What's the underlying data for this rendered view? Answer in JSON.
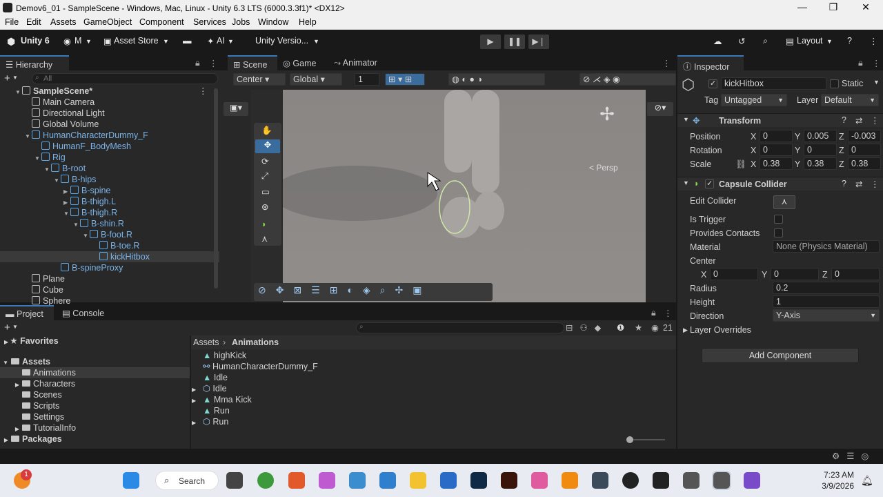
{
  "window": {
    "title": "Demov6_01 - SampleScene - Windows, Mac, Linux - Unity 6.3 LTS (6000.3.3f1)* <DX12>",
    "minimize": "—",
    "maximize": "❐",
    "close": "✕"
  },
  "menu": [
    "File",
    "Edit",
    "Assets",
    "GameObject",
    "Component",
    "Services",
    "Jobs",
    "Window",
    "Help"
  ],
  "toolbar": {
    "product": "Unity 6",
    "account": "M",
    "asset_store": "Asset Store",
    "ai": "AI",
    "version_control": "Unity Versio...",
    "layout": "Layout"
  },
  "hierarchy": {
    "tab": "Hierarchy",
    "search_placeholder": "All",
    "rows": [
      {
        "label": "SampleScene*",
        "indent": 0
      },
      {
        "label": "Main Camera",
        "indent": 1
      },
      {
        "label": "Directional Light",
        "indent": 1
      },
      {
        "label": "Global Volume",
        "indent": 1
      },
      {
        "label": "HumanCharacterDummy_F",
        "indent": 1
      },
      {
        "label": "HumanF_BodyMesh",
        "indent": 2
      },
      {
        "label": "Rig",
        "indent": 2
      },
      {
        "label": "B-root",
        "indent": 3
      },
      {
        "label": "B-hips",
        "indent": 4
      },
      {
        "label": "B-spine",
        "indent": 5
      },
      {
        "label": "B-thigh.L",
        "indent": 5
      },
      {
        "label": "B-thigh.R",
        "indent": 5
      },
      {
        "label": "B-shin.R",
        "indent": 6
      },
      {
        "label": "B-foot.R",
        "indent": 7
      },
      {
        "label": "B-toe.R",
        "indent": 8
      },
      {
        "label": "kickHitbox",
        "indent": 8
      },
      {
        "label": "B-spineProxy",
        "indent": 4
      },
      {
        "label": "Plane",
        "indent": 1
      },
      {
        "label": "Cube",
        "indent": 1
      },
      {
        "label": "Sphere",
        "indent": 1
      }
    ]
  },
  "scene": {
    "tabs": [
      "Scene",
      "Game",
      "Animator"
    ],
    "pivot": "Center",
    "space": "Global",
    "grid_value": "1",
    "persp_label": "< Persp"
  },
  "inspector": {
    "tab": "Inspector",
    "object_name": "kickHitbox",
    "static_label": "Static",
    "tag_label": "Tag",
    "tag_value": "Untagged",
    "layer_label": "Layer",
    "layer_value": "Default",
    "transform": {
      "title": "Transform",
      "position_label": "Position",
      "rotation_label": "Rotation",
      "scale_label": "Scale",
      "position": [
        "0",
        "0.005",
        "-0.003"
      ],
      "rotation": [
        "0",
        "0",
        "0"
      ],
      "scale": [
        "0.38",
        "0.38",
        "0.38"
      ]
    },
    "collider": {
      "title": "Capsule Collider",
      "edit_collider": "Edit Collider",
      "is_trigger": "Is Trigger",
      "provides_contacts": "Provides Contacts",
      "material_label": "Material",
      "material_value": "None (Physics Material)",
      "center_label": "Center",
      "center": [
        "0",
        "0",
        "0"
      ],
      "radius_label": "Radius",
      "radius": "0.2",
      "height_label": "Height",
      "height": "1",
      "direction_label": "Direction",
      "direction": "Y-Axis",
      "layer_overrides": "Layer Overrides"
    },
    "add_component": "Add Component",
    "axes": [
      "X",
      "Y",
      "Z"
    ]
  },
  "project": {
    "tabs": [
      "Project",
      "Console"
    ],
    "favorites": "Favorites",
    "assets": "Assets",
    "folders": [
      "Animations",
      "Characters",
      "Scenes",
      "Scripts",
      "Settings",
      "TutorialInfo"
    ],
    "packages": "Packages",
    "breadcrumb_root": "Assets",
    "breadcrumb_current": "Animations",
    "hidden_count": "21",
    "items": [
      "highKick",
      "HumanCharacterDummy_F",
      "Idle",
      "Idle",
      "Mma Kick",
      "Run",
      "Run"
    ]
  },
  "taskbar": {
    "search": "Search",
    "time": "7:23 AM",
    "date": "3/9/2026",
    "badge": "1"
  }
}
